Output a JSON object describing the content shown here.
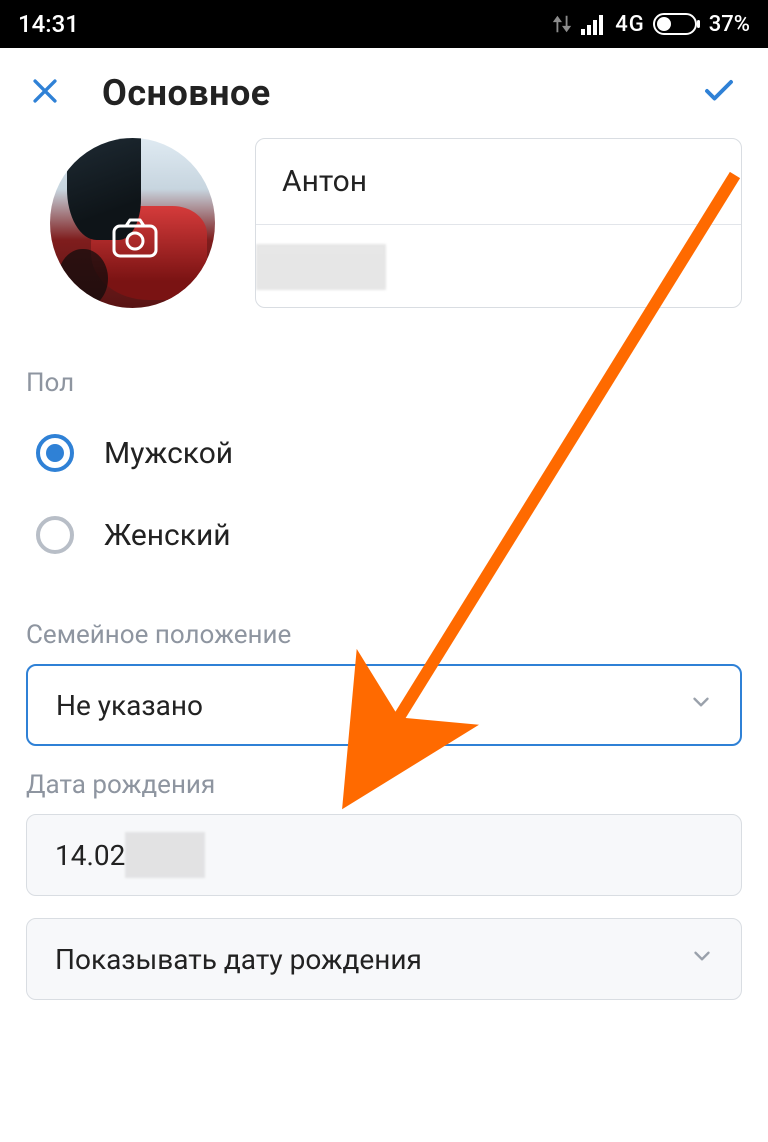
{
  "status": {
    "time": "14:31",
    "network": "4G",
    "battery_text": "37%"
  },
  "header": {
    "title": "Основное"
  },
  "profile": {
    "first_name": "Антон",
    "last_name": ""
  },
  "gender": {
    "label": "Пол",
    "options": [
      {
        "label": "Мужской",
        "selected": true
      },
      {
        "label": "Женский",
        "selected": false
      }
    ]
  },
  "relationship": {
    "label": "Семейное положение",
    "value": "Не указано"
  },
  "birthdate": {
    "label": "Дата рождения",
    "value": "14.02",
    "visibility_label": "Показывать дату рождения"
  },
  "icons": {
    "close": "close-icon",
    "confirm": "check-icon",
    "camera": "camera-icon",
    "chevron": "chevron-down-icon"
  }
}
